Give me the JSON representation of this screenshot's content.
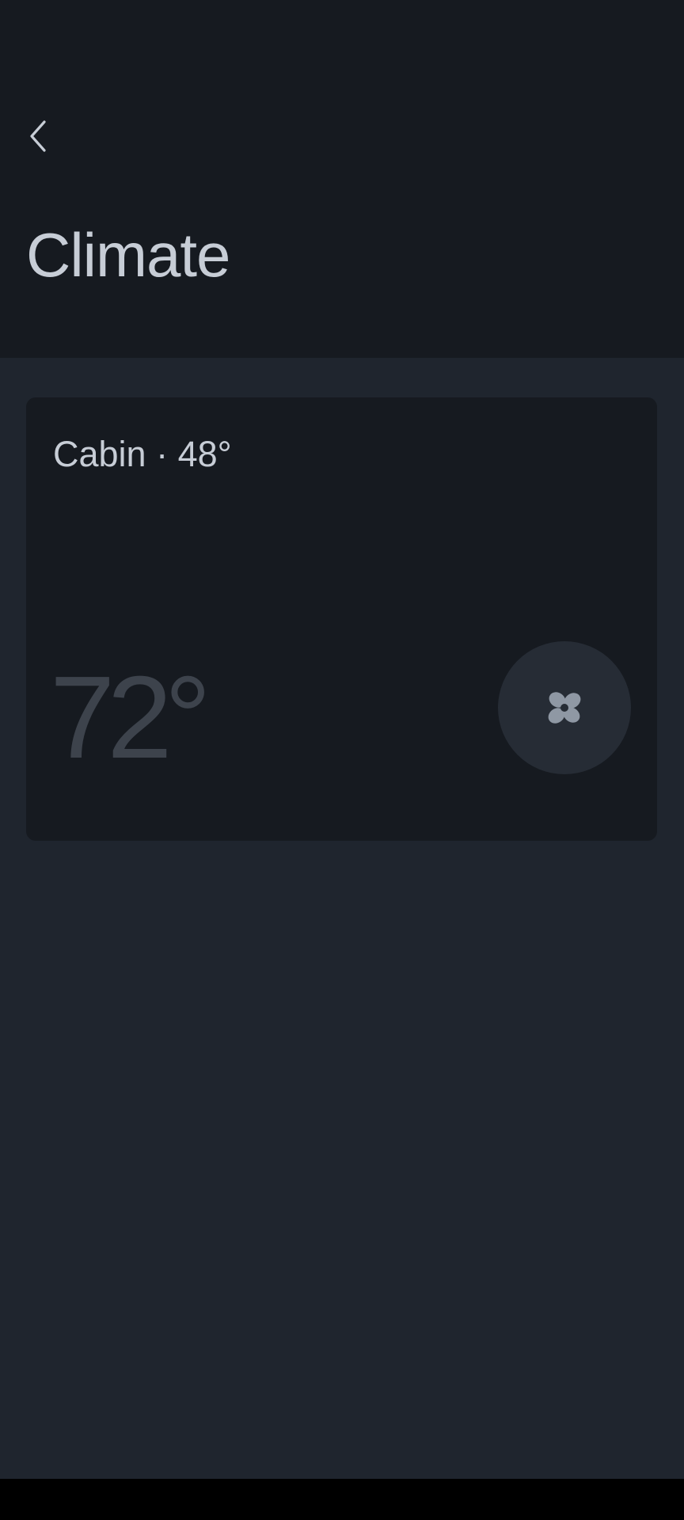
{
  "header": {
    "back_icon": "chevron-left-icon",
    "title": "Climate"
  },
  "card": {
    "label": "Cabin · 48°",
    "temperature": "72°",
    "fan_icon": "fan-icon"
  },
  "colors": {
    "background": "#161a20",
    "content_background": "#1f252e",
    "card_background": "#161a20",
    "primary_text": "#c7cdd6",
    "muted_temperature": "#3d434c",
    "fan_button_background": "#262c35",
    "fan_icon": "#8f98a4"
  }
}
